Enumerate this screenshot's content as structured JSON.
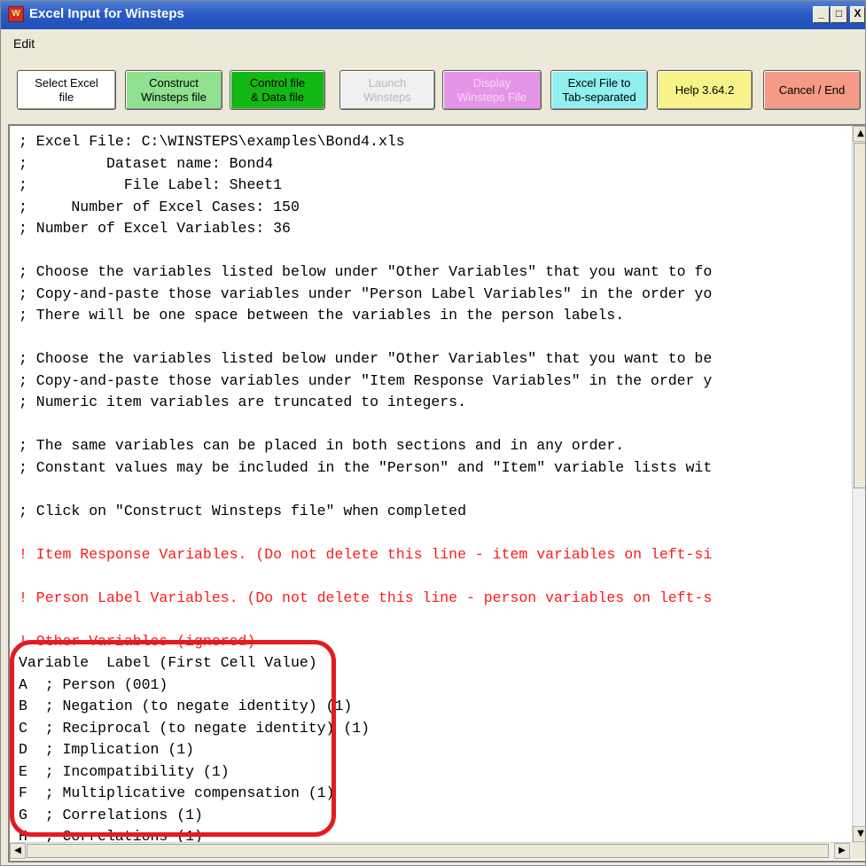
{
  "window": {
    "title": "Excel Input for Winsteps",
    "app_icon": "winsteps-icon",
    "controls": {
      "minimize": "_",
      "maximize": "□",
      "close": "X"
    }
  },
  "menu": {
    "edit": "Edit"
  },
  "toolbar": {
    "buttons": [
      {
        "line1": "Select Excel",
        "line2": "file",
        "color": "#ffffff",
        "enabled": true
      },
      {
        "line1": "Construct",
        "line2": "Winsteps file",
        "color": "#8fe08f",
        "enabled": true
      },
      {
        "line1": "Control file",
        "line2": "& Data file",
        "color": "#14b814",
        "enabled": true
      },
      {
        "line1": "Launch",
        "line2": "Winsteps",
        "color": "#f0f0f0",
        "enabled": false
      },
      {
        "line1": "Display",
        "line2": "Winsteps File",
        "color": "#e595e8",
        "enabled": false
      },
      {
        "line1": "Excel File to",
        "line2": "Tab-separated",
        "color": "#8ff0ee",
        "enabled": true
      },
      {
        "line1": "Help 3.64.2",
        "line2": "",
        "color": "#f8f28a",
        "enabled": true
      },
      {
        "line1": "Cancel / End",
        "line2": "",
        "color": "#f49a86",
        "enabled": true
      }
    ]
  },
  "editor": {
    "lines": [
      {
        "text": "; Excel File: C:\\WINSTEPS\\examples\\Bond4.xls",
        "red": false
      },
      {
        "text": ";         Dataset name: Bond4",
        "red": false
      },
      {
        "text": ";           File Label: Sheet1",
        "red": false
      },
      {
        "text": ";     Number of Excel Cases: 150",
        "red": false
      },
      {
        "text": "; Number of Excel Variables: 36",
        "red": false
      },
      {
        "text": "",
        "red": false
      },
      {
        "text": "; Choose the variables listed below under \"Other Variables\" that you want to fo",
        "red": false
      },
      {
        "text": "; Copy-and-paste those variables under \"Person Label Variables\" in the order yo",
        "red": false
      },
      {
        "text": "; There will be one space between the variables in the person labels.",
        "red": false
      },
      {
        "text": "",
        "red": false
      },
      {
        "text": "; Choose the variables listed below under \"Other Variables\" that you want to be",
        "red": false
      },
      {
        "text": "; Copy-and-paste those variables under \"Item Response Variables\" in the order y",
        "red": false
      },
      {
        "text": "; Numeric item variables are truncated to integers.",
        "red": false
      },
      {
        "text": "",
        "red": false
      },
      {
        "text": "; The same variables can be placed in both sections and in any order.",
        "red": false
      },
      {
        "text": "; Constant values may be included in the \"Person\" and \"Item\" variable lists wit",
        "red": false
      },
      {
        "text": "",
        "red": false
      },
      {
        "text": "; Click on \"Construct Winsteps file\" when completed",
        "red": false
      },
      {
        "text": "",
        "red": false
      },
      {
        "text": "! Item Response Variables. (Do not delete this line - item variables on left-si",
        "red": true
      },
      {
        "text": "",
        "red": false
      },
      {
        "text": "! Person Label Variables. (Do not delete this line - person variables on left-s",
        "red": true
      },
      {
        "text": "",
        "red": false
      },
      {
        "text": "! Other Variables (ignored)",
        "red": true
      },
      {
        "text": "Variable  Label (First Cell Value)",
        "red": false
      },
      {
        "text": "A  ; Person (001)",
        "red": false
      },
      {
        "text": "B  ; Negation (to negate identity) (1)",
        "red": false
      },
      {
        "text": "C  ; Reciprocal (to negate identity) (1)",
        "red": false
      },
      {
        "text": "D  ; Implication (1)",
        "red": false
      },
      {
        "text": "E  ; Incompatibility (1)",
        "red": false
      },
      {
        "text": "F  ; Multiplicative compensation (1)",
        "red": false
      },
      {
        "text": "G  ; Correlations (1)",
        "red": false
      },
      {
        "text": "H  ; Correlations (1)",
        "red": false
      }
    ],
    "highlight_color": "#e31b23"
  },
  "scrollbars": {
    "up": "▲",
    "down": "▼",
    "left": "◀",
    "right": "▶"
  }
}
